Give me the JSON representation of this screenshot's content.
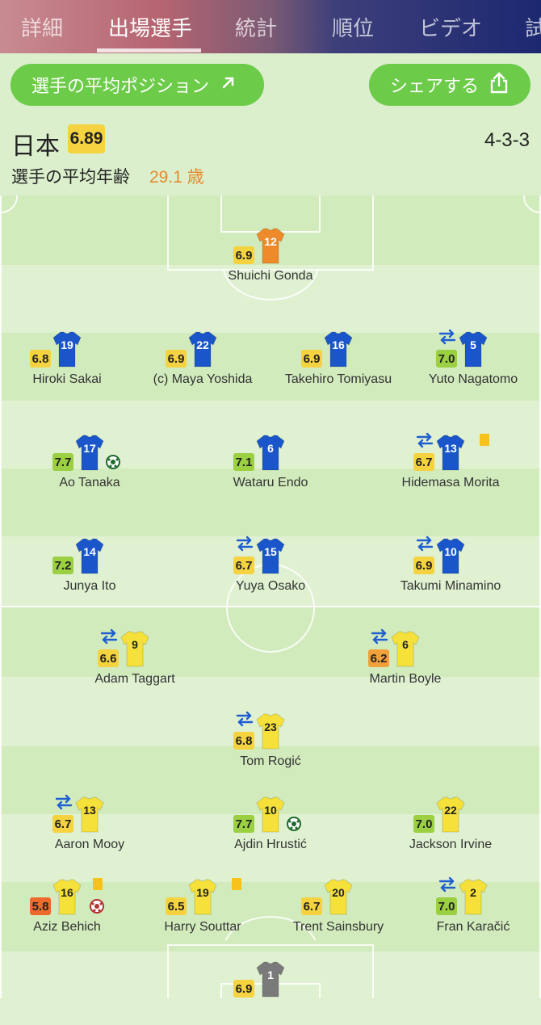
{
  "tabs": [
    {
      "label": "詳細",
      "active": false
    },
    {
      "label": "出場選手",
      "active": true
    },
    {
      "label": "統計",
      "active": false
    },
    {
      "label": "順位",
      "active": false
    },
    {
      "label": "ビデオ",
      "active": false
    },
    {
      "label": "試",
      "active": false
    }
  ],
  "buttons": {
    "avg_position": "選手の平均ポジション",
    "share": "シェアする"
  },
  "team": {
    "name": "日本",
    "rating": "6.89",
    "formation": "4-3-3",
    "avg_age_label": "選手の平均年齢",
    "avg_age_value": "29.1 歳"
  },
  "colors": {
    "accent_green": "#6ccb49",
    "rating_yellow": "#f5d340",
    "rating_green": "#9ad041",
    "rating_orange": "#f0a13a",
    "rating_red": "#ed6a2c",
    "japan_shirt": "#1a56c9",
    "japan_gk_shirt": "#ef8a2a",
    "australia_shirt": "#f5e13a",
    "australia_gk_shirt": "#7a7a7a"
  },
  "players": [
    {
      "name": "Shuichi Gonda",
      "number": "12",
      "rating": "6.9",
      "team": "home",
      "gk": true,
      "sub": false,
      "goal": false,
      "card": false,
      "own_goal": false
    },
    {
      "name": "Hiroki Sakai",
      "number": "19",
      "rating": "6.8",
      "team": "home",
      "gk": false,
      "sub": false,
      "goal": false,
      "card": false,
      "own_goal": false
    },
    {
      "name": "(c) Maya Yoshida",
      "number": "22",
      "rating": "6.9",
      "team": "home",
      "gk": false,
      "sub": false,
      "goal": false,
      "card": false,
      "own_goal": false
    },
    {
      "name": "Takehiro Tomiyasu",
      "number": "16",
      "rating": "6.9",
      "team": "home",
      "gk": false,
      "sub": false,
      "goal": false,
      "card": false,
      "own_goal": false
    },
    {
      "name": "Yuto Nagatomo",
      "number": "5",
      "rating": "7.0",
      "team": "home",
      "gk": false,
      "sub": true,
      "goal": false,
      "card": false,
      "own_goal": false
    },
    {
      "name": "Ao Tanaka",
      "number": "17",
      "rating": "7.7",
      "team": "home",
      "gk": false,
      "sub": false,
      "goal": true,
      "card": false,
      "own_goal": false
    },
    {
      "name": "Wataru Endo",
      "number": "6",
      "rating": "7.1",
      "team": "home",
      "gk": false,
      "sub": false,
      "goal": false,
      "card": false,
      "own_goal": false
    },
    {
      "name": "Hidemasa Morita",
      "number": "13",
      "rating": "6.7",
      "team": "home",
      "gk": false,
      "sub": true,
      "goal": false,
      "card": true,
      "own_goal": false
    },
    {
      "name": "Junya Ito",
      "number": "14",
      "rating": "7.2",
      "team": "home",
      "gk": false,
      "sub": false,
      "goal": false,
      "card": false,
      "own_goal": false
    },
    {
      "name": "Yuya Osako",
      "number": "15",
      "rating": "6.7",
      "team": "home",
      "gk": false,
      "sub": true,
      "goal": false,
      "card": false,
      "own_goal": false
    },
    {
      "name": "Takumi Minamino",
      "number": "10",
      "rating": "6.9",
      "team": "home",
      "gk": false,
      "sub": true,
      "goal": false,
      "card": false,
      "own_goal": false
    },
    {
      "name": "Adam Taggart",
      "number": "9",
      "rating": "6.6",
      "team": "away",
      "gk": false,
      "sub": true,
      "goal": false,
      "card": false,
      "own_goal": false
    },
    {
      "name": "Martin Boyle",
      "number": "6",
      "rating": "6.2",
      "team": "away",
      "gk": false,
      "sub": true,
      "goal": false,
      "card": false,
      "own_goal": false
    },
    {
      "name": "Tom Rogić",
      "number": "23",
      "rating": "6.8",
      "team": "away",
      "gk": false,
      "sub": true,
      "goal": false,
      "card": false,
      "own_goal": false
    },
    {
      "name": "Aaron Mooy",
      "number": "13",
      "rating": "6.7",
      "team": "away",
      "gk": false,
      "sub": true,
      "goal": false,
      "card": false,
      "own_goal": false
    },
    {
      "name": "Ajdin Hrustić",
      "number": "10",
      "rating": "7.7",
      "team": "away",
      "gk": false,
      "sub": false,
      "goal": true,
      "card": false,
      "own_goal": false
    },
    {
      "name": "Jackson Irvine",
      "number": "22",
      "rating": "7.0",
      "team": "away",
      "gk": false,
      "sub": false,
      "goal": false,
      "card": false,
      "own_goal": false
    },
    {
      "name": "Aziz Behich",
      "number": "16",
      "rating": "5.8",
      "team": "away",
      "gk": false,
      "sub": false,
      "goal": false,
      "card": true,
      "own_goal": true
    },
    {
      "name": "Harry Souttar",
      "number": "19",
      "rating": "6.5",
      "team": "away",
      "gk": false,
      "sub": false,
      "goal": false,
      "card": true,
      "own_goal": false
    },
    {
      "name": "Trent Sainsbury",
      "number": "20",
      "rating": "6.7",
      "team": "away",
      "gk": false,
      "sub": false,
      "goal": false,
      "card": false,
      "own_goal": false
    },
    {
      "name": "Fran Karačić",
      "number": "2",
      "rating": "7.0",
      "team": "away",
      "gk": false,
      "sub": true,
      "goal": false,
      "card": false,
      "own_goal": false
    },
    {
      "name": "",
      "number": "1",
      "rating": "6.9",
      "team": "away",
      "gk": true,
      "sub": false,
      "goal": false,
      "card": false,
      "own_goal": false
    }
  ]
}
